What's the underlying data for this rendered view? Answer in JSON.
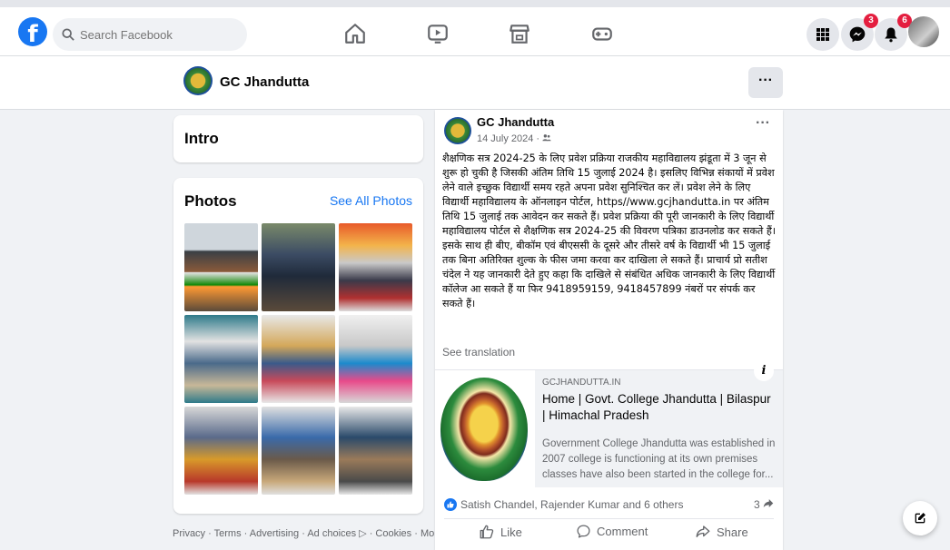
{
  "topbar": {
    "logo": "f",
    "search_placeholder": "Search Facebook",
    "nav_icons": [
      "home-icon",
      "video-icon",
      "marketplace-icon",
      "gaming-icon"
    ],
    "menu_icon": "grid-menu-icon",
    "messenger_badge": "3",
    "notifications_badge": "6"
  },
  "page": {
    "name": "GC Jhandutta",
    "more_label": "···"
  },
  "intro": {
    "title": "Intro"
  },
  "photos": {
    "title": "Photos",
    "see_all": "See All Photos"
  },
  "footer": {
    "links": "Privacy · Terms · Advertising · Ad choices ▷ · Cookies · More"
  },
  "post": {
    "author": "GC Jhandutta",
    "date": "14 July 2024 · ",
    "menu": "···",
    "text": "शैक्षणिक सत्र 2024-25 के लिए प्रवेश प्रक्रिया राजकीय महाविद्यालय झंडूता में 3 जून से शुरू हो चुकी है जिसकी अंतिम तिथि 15 जुलाई 2024 है। इसलिए विभिन्न संकायों में प्रवेश लेने वाले इच्छुक विद्यार्थी समय रहते अपना प्रवेश सुनिश्चित कर लें। प्रवेश लेने के लिए विद्यार्थी महाविद्यालय के ऑनलाइन पोर्टल, https//www.gcjhandutta.in पर अंतिम तिथि 15 जुलाई तक आवेदन कर सकते हैं। प्रवेश प्रक्रिया की पूरी जानकारी के लिए विद्यार्थी महाविद्यालय पोर्टल से शैक्षणिक सत्र 2024-25 की विवरण पत्रिका डाउनलोड कर सकते हैं। इसके साथ ही बीए, बीकॉम एवं बीएससी के दूसरे और तीसरे वर्ष के विद्यार्थी भी 15 जुलाई तक बिना अतिरिक्त शुल्क के फीस जमा करवा कर दाखिला ले सकते हैं। प्राचार्य प्रो सतीश चंदेल ने यह जानकारी देते हुए कहा कि दाखिले से संबंधित अधिक जानकारी के लिए विद्यार्थी कॉलेज आ सकते हैं या फिर 9418959159, 9418457899 नंबरों पर संपर्क कर सकते हैं।",
    "see_translation": "See translation",
    "link": {
      "domain": "GCJHANDUTTA.IN",
      "title": "Home | Govt. College Jhandutta | Bilaspur | Himachal Pradesh",
      "description": "Government College Jhandutta was established in 2007 college is functioning at its own premises classes have also been started in the college for...",
      "info": "i"
    },
    "reactions": "Satish Chandel, Rajender Kumar and 6 others",
    "shares": "3",
    "actions": {
      "like": "Like",
      "comment": "Comment",
      "share": "Share"
    }
  },
  "colors": {
    "brand": "#1877f2",
    "badge": "#e41e3f",
    "background": "#f0f2f5"
  }
}
